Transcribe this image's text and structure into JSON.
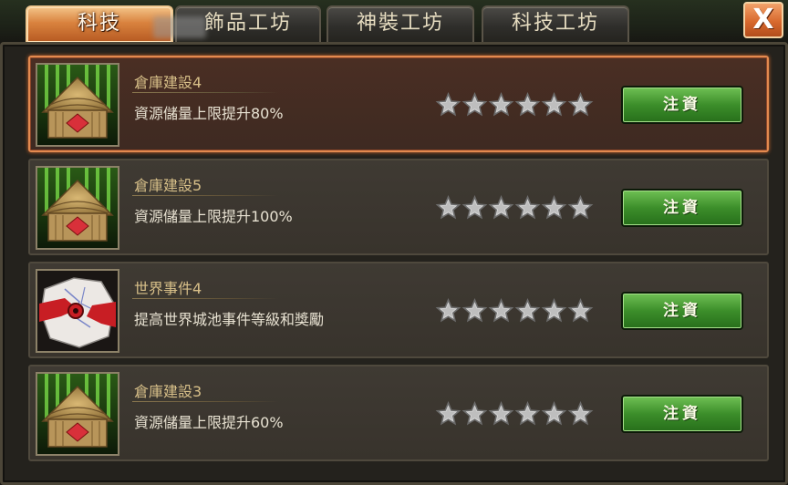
{
  "tabs": [
    {
      "label": "科技",
      "active": true
    },
    {
      "label": "飾品工坊",
      "active": false
    },
    {
      "label": "神裝工坊",
      "active": false
    },
    {
      "label": "科技工坊",
      "active": false
    }
  ],
  "close_label": "X",
  "colors": {
    "active_tab": "#d9823e",
    "selected_border": "#e38a4f",
    "invest_button": "#3c8e2a",
    "name_text": "#d8c089",
    "star_empty": "#cfcfcf"
  },
  "tech_items": [
    {
      "name": "倉庫建設4",
      "description": "資源儲量上限提升80%",
      "icon": "warehouse-hut-icon",
      "stars_filled": 0,
      "stars_total": 6,
      "button": "注資",
      "selected": true
    },
    {
      "name": "倉庫建設5",
      "description": "資源儲量上限提升100%",
      "icon": "warehouse-hut-icon",
      "stars_filled": 0,
      "stars_total": 6,
      "button": "注資",
      "selected": false
    },
    {
      "name": "世界事件4",
      "description": "提高世界城池事件等級和獎勵",
      "icon": "world-event-icon",
      "stars_filled": 0,
      "stars_total": 6,
      "button": "注資",
      "selected": false
    },
    {
      "name": "倉庫建設3",
      "description": "資源儲量上限提升60%",
      "icon": "warehouse-hut-icon",
      "stars_filled": 0,
      "stars_total": 6,
      "button": "注資",
      "selected": false
    }
  ]
}
